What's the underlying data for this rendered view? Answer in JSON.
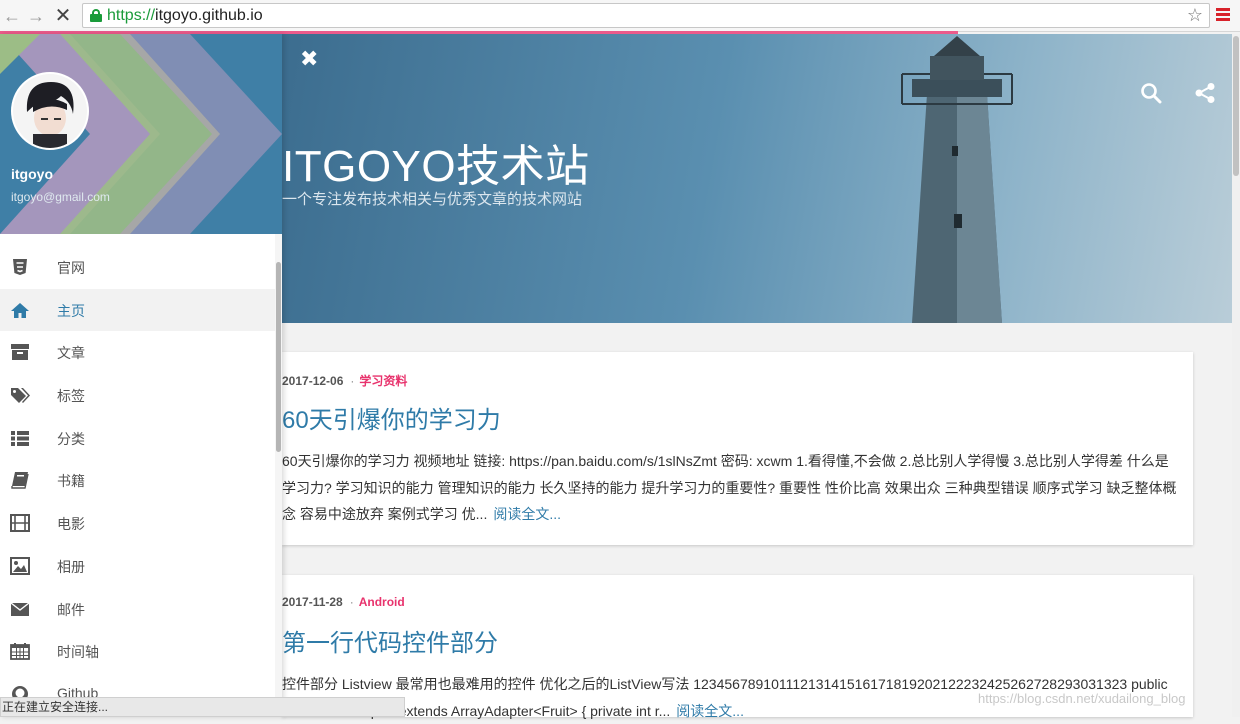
{
  "browser": {
    "url_scheme": "https://",
    "url_host": "itgoyo.github.io",
    "status_text": "正在建立安全连接..."
  },
  "header": {
    "title": "ITGOYO技术站",
    "subtitle": "一个专注发布技术相关与优秀文章的技术网站"
  },
  "sidebar": {
    "name": "itgoyo",
    "email": "itgoyo@gmail.com",
    "items": [
      {
        "label": "官网",
        "icon": "html5-icon"
      },
      {
        "label": "主页",
        "icon": "home-icon",
        "active": true
      },
      {
        "label": "文章",
        "icon": "archive-icon"
      },
      {
        "label": "标签",
        "icon": "tags-icon"
      },
      {
        "label": "分类",
        "icon": "list-icon"
      },
      {
        "label": "书籍",
        "icon": "book-icon"
      },
      {
        "label": "电影",
        "icon": "film-icon"
      },
      {
        "label": "相册",
        "icon": "image-icon"
      },
      {
        "label": "邮件",
        "icon": "envelope-icon"
      },
      {
        "label": "时间轴",
        "icon": "calendar-icon"
      },
      {
        "label": "Github",
        "icon": "github-icon"
      }
    ]
  },
  "posts": [
    {
      "date": "2017-12-06",
      "category": "学习资料",
      "title": "60天引爆你的学习力",
      "excerpt": "60天引爆你的学习力 视频地址 链接: https://pan.baidu.com/s/1slNsZmt 密码: xcwm 1.看得懂,不会做 2.总比别人学得慢 3.总比别人学得差 什么是学习力? 学习知识的能力 管理知识的能力 长久坚持的能力 提升学习力的重要性? 重要性 性价比高 效果出众 三种典型错误 顺序式学习 缺乏整体概念 容易中途放弃 案例式学习 优...",
      "read_more": "阅读全文..."
    },
    {
      "date": "2017-11-28",
      "category": "Android",
      "title": "第一行代码控件部分",
      "excerpt": "控件部分 Listview 最常用也最难用的控件 优化之后的ListView写法 12345678910111213141516171819202122232425262728293031323 public class FruitAdapter extends ArrayAdapter<Fruit> { private int r...",
      "read_more": "阅读全文..."
    }
  ],
  "watermark": "https://blog.csdn.net/xudailong_blog",
  "colors": {
    "accent": "#2f7ba8",
    "category": "#e8336d",
    "progress": "#ec5b8b"
  }
}
